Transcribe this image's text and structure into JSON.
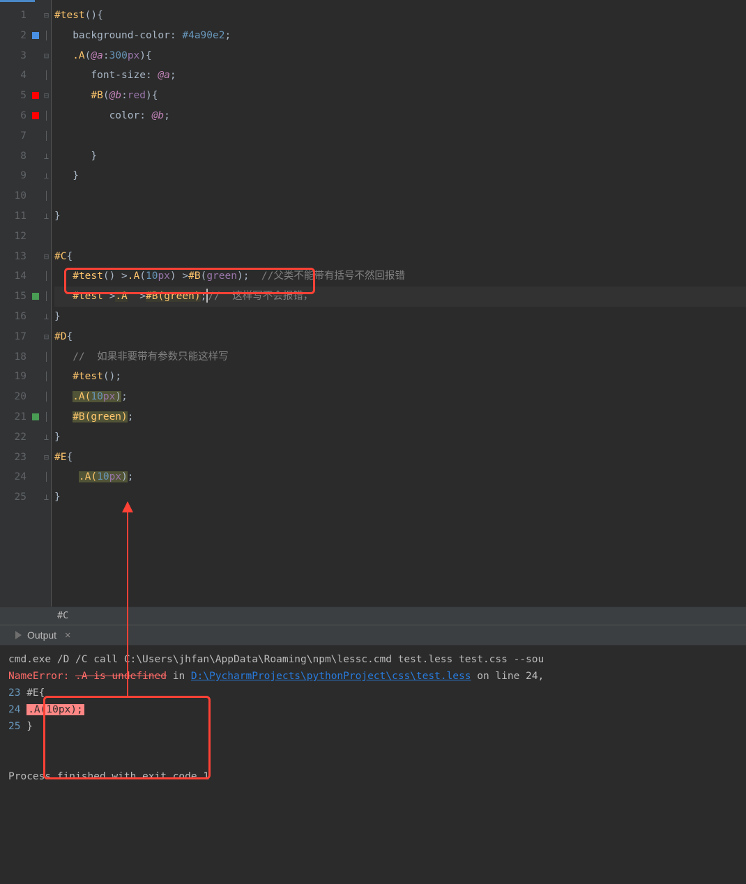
{
  "editor": {
    "lines": [
      {
        "n": "1"
      },
      {
        "n": "2",
        "mark": "blue"
      },
      {
        "n": "3"
      },
      {
        "n": "4"
      },
      {
        "n": "5",
        "mark": "red"
      },
      {
        "n": "6",
        "mark": "red"
      },
      {
        "n": "7"
      },
      {
        "n": "8"
      },
      {
        "n": "9"
      },
      {
        "n": "10"
      },
      {
        "n": "11"
      },
      {
        "n": "12"
      },
      {
        "n": "13"
      },
      {
        "n": "14"
      },
      {
        "n": "15",
        "mark": "green"
      },
      {
        "n": "16"
      },
      {
        "n": "17"
      },
      {
        "n": "18"
      },
      {
        "n": "19"
      },
      {
        "n": "20"
      },
      {
        "n": "21",
        "mark": "green"
      },
      {
        "n": "22"
      },
      {
        "n": "23"
      },
      {
        "n": "24"
      },
      {
        "n": "25"
      }
    ],
    "code": {
      "l1_sel": "#test",
      "l1_par": "(){",
      "l2_prop": "background-color",
      "l2_colon": ": ",
      "l2_val": "#4a90e2",
      "l2_semi": ";",
      "l3_sel": ".A",
      "l3_open": "(",
      "l3_var": "@a",
      "l3_colon": ":",
      "l3_num": "300",
      "l3_unit": "px",
      "l3_close": "){",
      "l4_prop": "font-size",
      "l4_colon": ": ",
      "l4_var": "@a",
      "l4_semi": ";",
      "l5_sel": "#B",
      "l5_open": "(",
      "l5_var": "@b",
      "l5_colon": ":",
      "l5_kw": "red",
      "l5_close": "){",
      "l6_prop": "color",
      "l6_colon": ": ",
      "l6_var": "@b",
      "l6_semi": ";",
      "l8_close": "}",
      "l9_close": "}",
      "l11_close": "}",
      "l13_sel": "#C",
      "l13_brace": "{",
      "l14_sel": "#test",
      "l14_p1": "() >",
      "l14_a": ".A",
      "l14_open": "(",
      "l14_num": "10",
      "l14_px": "px",
      "l14_p2": ") >",
      "l14_b": "#B",
      "l14_open2": "(",
      "l14_kw": "green",
      "l14_p3": ");",
      "l14_cmt": "//父类不能带有括号不然回报错",
      "l15_sel": "#test ",
      "l15_gt": ">",
      "l15_a": ".A",
      "l15_b": "  >",
      "l15_bb": "#B(green)",
      "l15_semi": ";",
      "l15_cmt": "//  这样写不会报错，",
      "l16_close": "}",
      "l17_sel": "#D",
      "l17_brace": "{",
      "l18_cmt": "//  如果非要带有参数只能这样写",
      "l19_sel": "#test",
      "l19_rest": "();",
      "l20_a": ".A(",
      "l20_num": "10",
      "l20_px": "px",
      "l20_close": ")",
      "l20_semi": ";",
      "l21_b": "#B(green)",
      "l21_semi": ";",
      "l22_close": "}",
      "l23_sel": "#E",
      "l23_brace": "{",
      "l24_a": ".A(",
      "l24_num": "10",
      "l24_px": "px",
      "l24_close": ")",
      "l24_semi": ";",
      "l25_close": "}"
    }
  },
  "breadcrumb": "#C",
  "output": {
    "title": "Output",
    "cmd": "cmd.exe /D /C call C:\\Users\\jhfan\\AppData\\Roaming\\npm\\lessc.cmd test.less test.css --sou",
    "err_label": "NameError: ",
    "err_msg": ".A is undefined",
    "err_in": " in ",
    "err_path": "D:\\PycharmProjects\\pythonProject\\css\\test.less",
    "err_line": " on line 24,",
    "ctx23_n": "23",
    "ctx23_txt": " #E{",
    "ctx24_n": "24",
    "ctx24_hl": ".A(10px);",
    "ctx25_n": "25",
    "ctx25_txt": " }",
    "finish": "Process finished with exit code 1"
  }
}
